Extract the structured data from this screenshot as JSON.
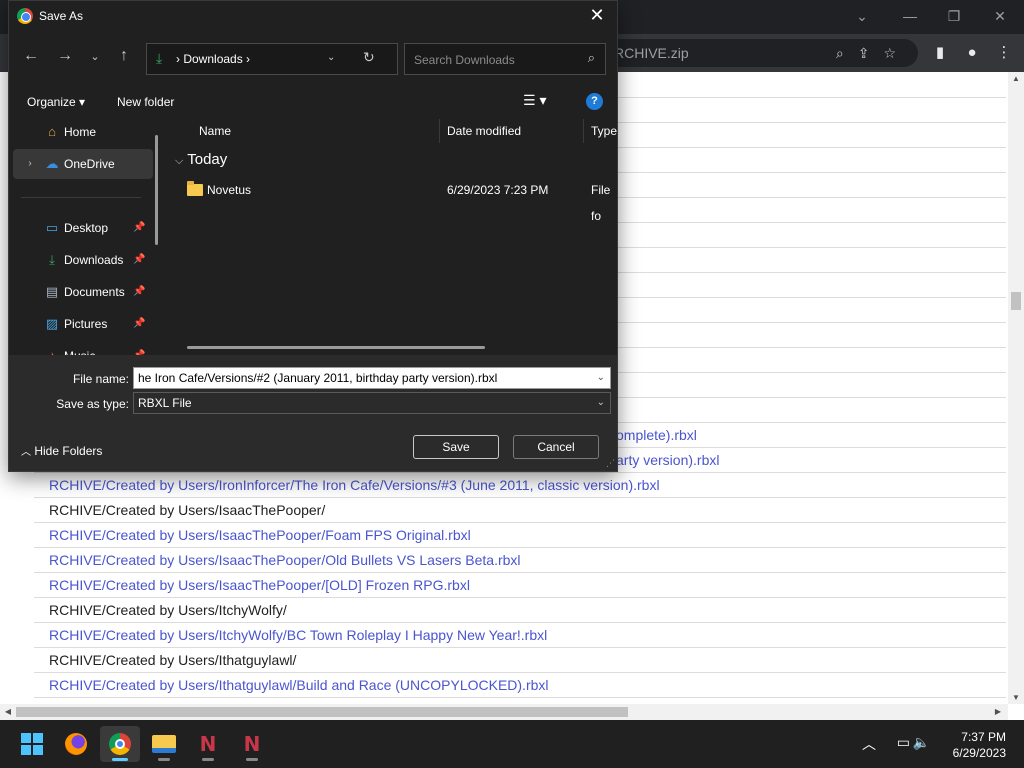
{
  "chrome": {
    "address_fragment": "RCHIVE.zip",
    "window_controls": [
      "chevron-down",
      "minimize",
      "restore",
      "close"
    ]
  },
  "listing": {
    "rows": [
      {
        "text": "",
        "type": "dir"
      },
      {
        "text": "",
        "type": "dir"
      },
      {
        "text": "",
        "type": "dir"
      },
      {
        "text": "",
        "type": "dir"
      },
      {
        "text": "",
        "type": "dir"
      },
      {
        "text": "",
        "type": "dir"
      },
      {
        "text": "",
        "type": "dir"
      },
      {
        "text": "",
        "type": "dir"
      },
      {
        "text": "",
        "type": "dir"
      },
      {
        "text": "",
        "type": "dir"
      },
      {
        "text": "",
        "type": "dir"
      },
      {
        "text": "",
        "type": "dir"
      },
      {
        "text": "",
        "type": "dir"
      },
      {
        "text": "",
        "type": "dir"
      },
      {
        "text": "omplete).rbxl",
        "type": "link",
        "offset": true
      },
      {
        "text": "arty version).rbxl",
        "type": "link",
        "offset": true
      },
      {
        "text": "RCHIVE/Created by Users/IronInforcer/The Iron Cafe/Versions/#3 (June 2011, classic version).rbxl",
        "type": "link"
      },
      {
        "text": "RCHIVE/Created by Users/IsaacThePooper/",
        "type": "dir"
      },
      {
        "text": "RCHIVE/Created by Users/IsaacThePooper/Foam FPS Original.rbxl",
        "type": "link"
      },
      {
        "text": "RCHIVE/Created by Users/IsaacThePooper/Old Bullets VS Lasers Beta.rbxl",
        "type": "link"
      },
      {
        "text": "RCHIVE/Created by Users/IsaacThePooper/[OLD] Frozen RPG.rbxl",
        "type": "link"
      },
      {
        "text": "RCHIVE/Created by Users/ItchyWolfy/",
        "type": "dir"
      },
      {
        "text": "RCHIVE/Created by Users/ItchyWolfy/BC Town Roleplay I Happy New Year!.rbxl",
        "type": "link"
      },
      {
        "text": "RCHIVE/Created by Users/Ithatguylawl/",
        "type": "dir"
      },
      {
        "text": "RCHIVE/Created by Users/Ithatguylawl/Build and Race (UNCOPYLOCKED).rbxl",
        "type": "link"
      }
    ]
  },
  "dialog": {
    "title": "Save As",
    "breadcrumb": "Downloads",
    "search_placeholder": "Search Downloads",
    "organize_label": "Organize",
    "new_folder_label": "New folder",
    "help_label": "?",
    "nav_items": [
      {
        "label": "Home",
        "icon": "home-icon",
        "pinned": false
      },
      {
        "label": "OneDrive",
        "icon": "onedrive-icon",
        "pinned": false,
        "selected": true
      },
      {
        "label": "Desktop",
        "icon": "desktop-icon",
        "pinned": true
      },
      {
        "label": "Downloads",
        "icon": "downloads-icon",
        "pinned": true
      },
      {
        "label": "Documents",
        "icon": "documents-icon",
        "pinned": true
      },
      {
        "label": "Pictures",
        "icon": "pictures-icon",
        "pinned": true
      },
      {
        "label": "Music",
        "icon": "music-icon",
        "pinned": true
      }
    ],
    "columns": [
      "Name",
      "Date modified",
      "Type"
    ],
    "group_label": "Today",
    "files": [
      {
        "name": "Novetus",
        "date": "6/29/2023 7:23 PM",
        "type": "File fo"
      }
    ],
    "file_name_label": "File name:",
    "file_name_value": "he Iron Cafe/Versions/#2 (January 2011, birthday party version).rbxl",
    "save_type_label": "Save as type:",
    "save_type_value": "RBXL File",
    "hide_folders_label": "Hide Folders",
    "save_label": "Save",
    "cancel_label": "Cancel"
  },
  "taskbar": {
    "time": "7:37 PM",
    "date": "6/29/2023",
    "apps": [
      "start-icon",
      "firefox-icon",
      "chrome-icon",
      "file-explorer-icon",
      "novetus-icon",
      "novetus-icon"
    ]
  },
  "colors": {
    "link": "#4a55cf",
    "dialog_bg": "#202020",
    "accent": "#60cdff"
  }
}
